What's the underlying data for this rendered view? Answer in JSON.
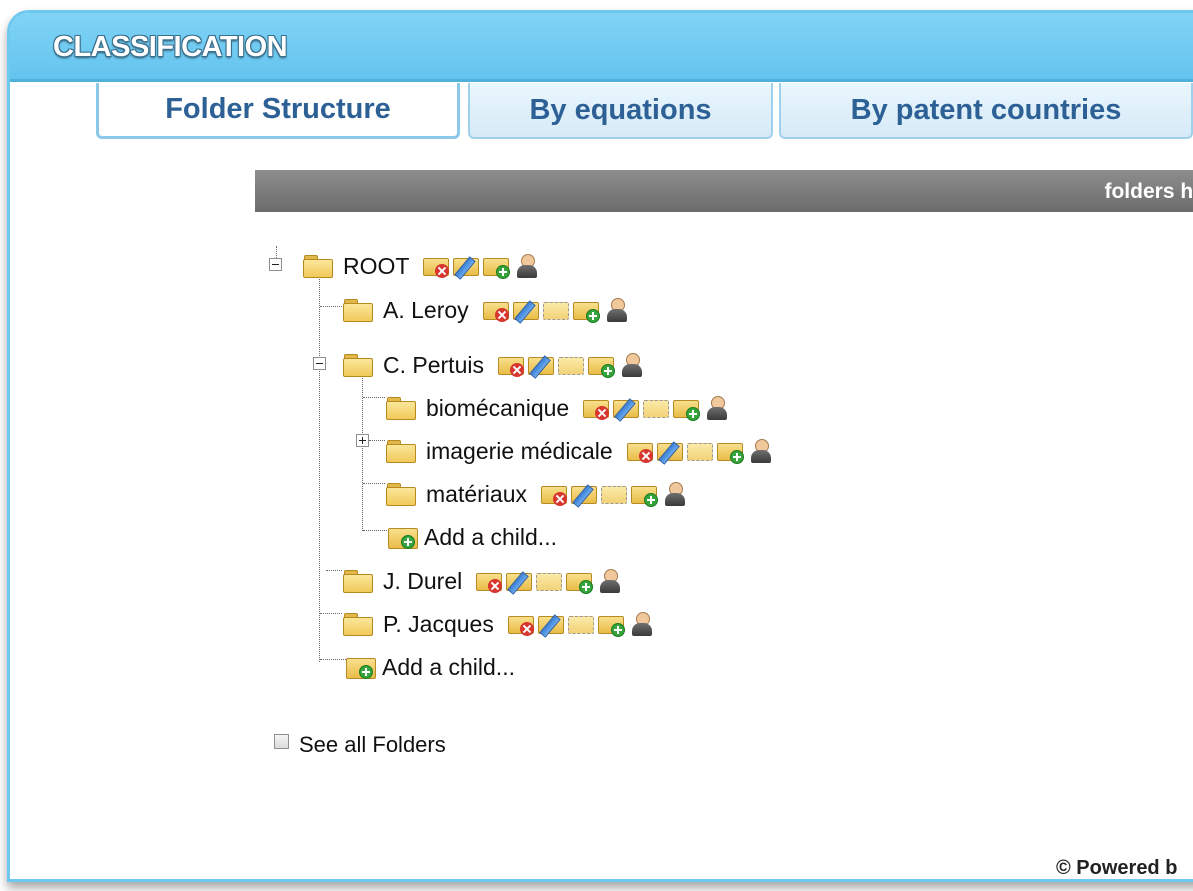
{
  "header": {
    "title": "CLASSIFICATION"
  },
  "tabs": [
    {
      "label": "Folder Structure",
      "active": true
    },
    {
      "label": "By equations",
      "active": false
    },
    {
      "label": "By patent countries",
      "active": false
    }
  ],
  "section_bar": {
    "label": "folders hi"
  },
  "tree": {
    "root": {
      "label": "ROOT",
      "expanded": true,
      "actions": [
        "folder-delete-icon",
        "folder-edit-icon",
        "folder-add-icon",
        "user-icon"
      ]
    },
    "children": [
      {
        "label": "A. Leroy",
        "actions": [
          "folder-delete-icon",
          "folder-edit-icon",
          "folder-move-icon",
          "folder-add-icon",
          "user-icon"
        ]
      },
      {
        "label": "C. Pertuis",
        "expanded": true,
        "actions": [
          "folder-delete-icon",
          "folder-edit-icon",
          "folder-move-icon",
          "folder-add-icon",
          "user-icon"
        ],
        "children": [
          {
            "label": "biomécanique",
            "actions": [
              "folder-delete-icon",
              "folder-edit-icon",
              "folder-move-icon",
              "folder-add-icon",
              "user-icon"
            ]
          },
          {
            "label": "imagerie médicale",
            "collapsed": true,
            "actions": [
              "folder-delete-icon",
              "folder-edit-icon",
              "folder-move-icon",
              "folder-add-icon",
              "user-icon"
            ]
          },
          {
            "label": "matériaux",
            "actions": [
              "folder-delete-icon",
              "folder-edit-icon",
              "folder-move-icon",
              "folder-add-icon",
              "user-icon"
            ]
          }
        ],
        "add_child_label": "Add a child..."
      },
      {
        "label": "J. Durel",
        "actions": [
          "folder-delete-icon",
          "folder-edit-icon",
          "folder-move-icon",
          "folder-add-icon",
          "user-icon"
        ]
      },
      {
        "label": "P. Jacques",
        "actions": [
          "folder-delete-icon",
          "folder-edit-icon",
          "folder-move-icon",
          "folder-add-icon",
          "user-icon"
        ]
      }
    ],
    "add_child_label": "Add a child..."
  },
  "see_all": {
    "label": "See all Folders",
    "checked": false
  },
  "footer": {
    "text": "© Powered b"
  },
  "colors": {
    "header": "#6ec9ef",
    "tab_text": "#2d6196",
    "bar": "#7a7a7a"
  }
}
